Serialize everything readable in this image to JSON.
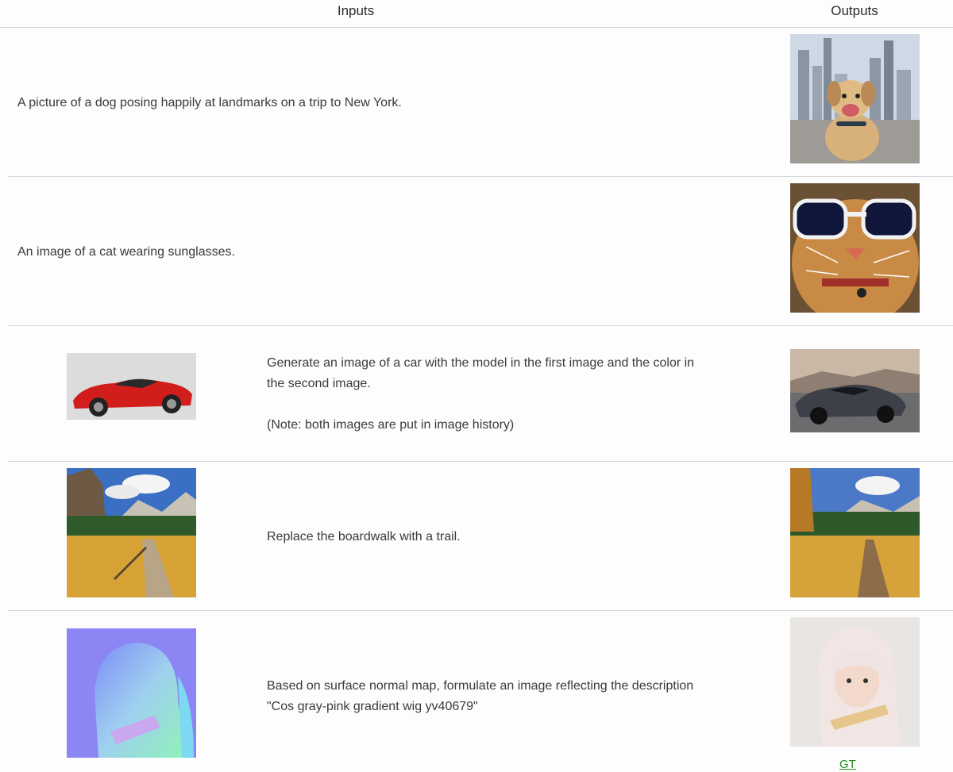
{
  "header": {
    "inputs_label": "Inputs",
    "outputs_label": "Outputs"
  },
  "rows": [
    {
      "text": "A picture of a dog posing happily at landmarks on a trip to New York.",
      "output_image": "dog-new-york-image"
    },
    {
      "text": "An image of a cat wearing sunglasses.",
      "output_image": "cat-sunglasses-image"
    },
    {
      "input_image": "red-sports-car-image",
      "text_lines": [
        "Generate an image of a car with the model in the first image and the color in the second image."
      ],
      "note": "(Note: both images are put in image history)",
      "output_image": "grey-sports-car-image"
    },
    {
      "input_image": "boardwalk-meadow-image",
      "text": "Replace the boardwalk with a trail.",
      "output_image": "trail-meadow-image"
    },
    {
      "input_image": "surface-normal-map-image",
      "text": "Based on surface normal map, formulate an image reflecting the description \"Cos gray-pink gradient wig yv40679\"",
      "output_image": "pink-wig-portrait-image",
      "link_label": "GT"
    }
  ],
  "colors": {
    "link": "#1e8f1e",
    "divider": "#d6d6d6"
  }
}
